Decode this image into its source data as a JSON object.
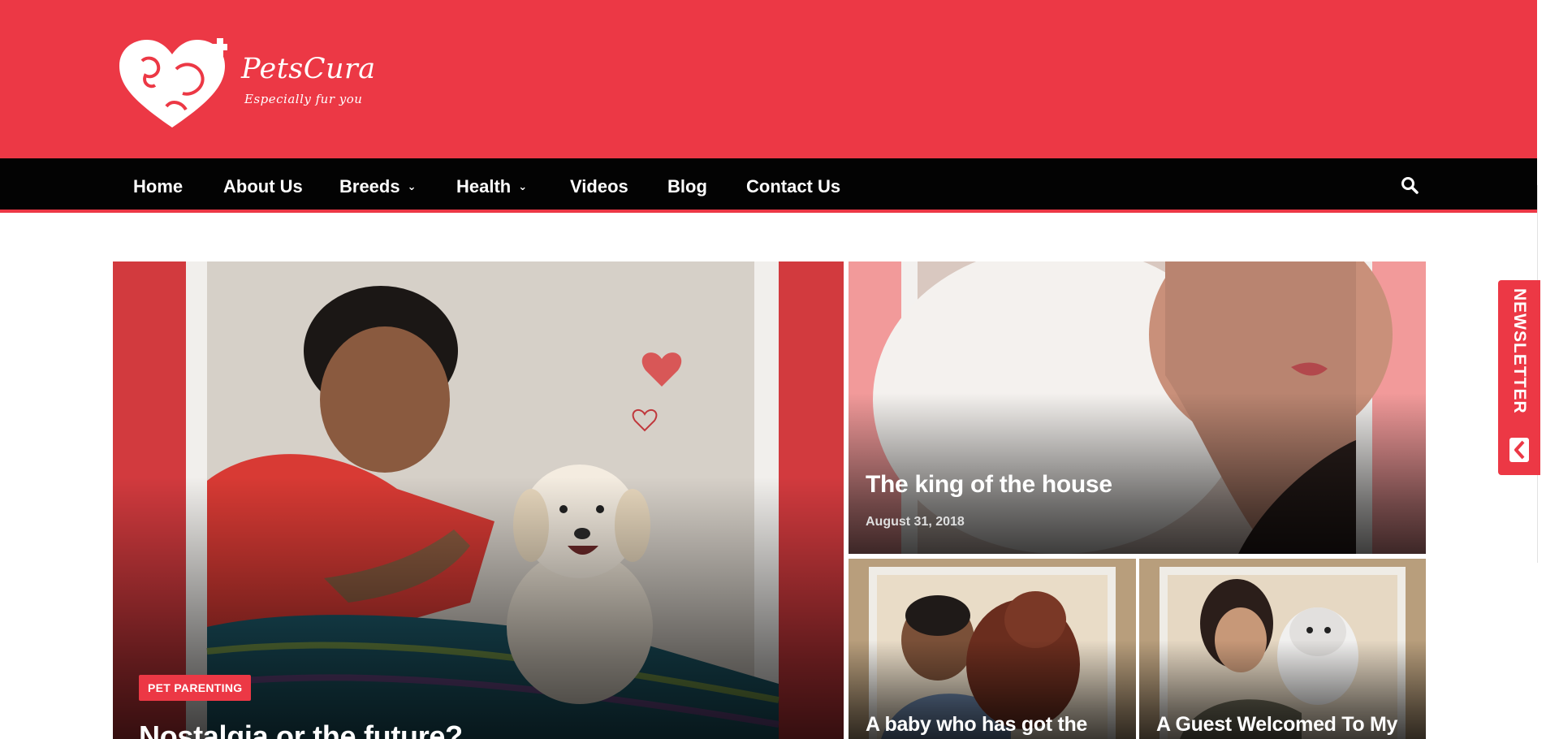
{
  "brand": {
    "name": "PetsCura",
    "tagline": "Especially fur you",
    "header_color": "#ec3845"
  },
  "nav": {
    "items": [
      {
        "label": "Home",
        "has_dropdown": false
      },
      {
        "label": "About Us",
        "has_dropdown": false
      },
      {
        "label": "Breeds",
        "has_dropdown": true
      },
      {
        "label": "Health",
        "has_dropdown": true
      },
      {
        "label": "Videos",
        "has_dropdown": false
      },
      {
        "label": "Blog",
        "has_dropdown": false
      },
      {
        "label": "Contact Us",
        "has_dropdown": false
      }
    ],
    "search_icon": "search-icon"
  },
  "featured": {
    "main": {
      "category": "PET PARENTING",
      "title": "Nostalgia or the future?"
    },
    "top_right": {
      "title": "The king of the house",
      "date": "August 31, 2018"
    },
    "bottom_left": {
      "title": "A baby who has got the"
    },
    "bottom_right": {
      "title": "A Guest Welcomed To My"
    }
  },
  "newsletter": {
    "label": "NEWSLETTER",
    "icon": "newsletter-icon"
  },
  "colors": {
    "accent": "#ec3845",
    "nav_bg": "#030303"
  }
}
